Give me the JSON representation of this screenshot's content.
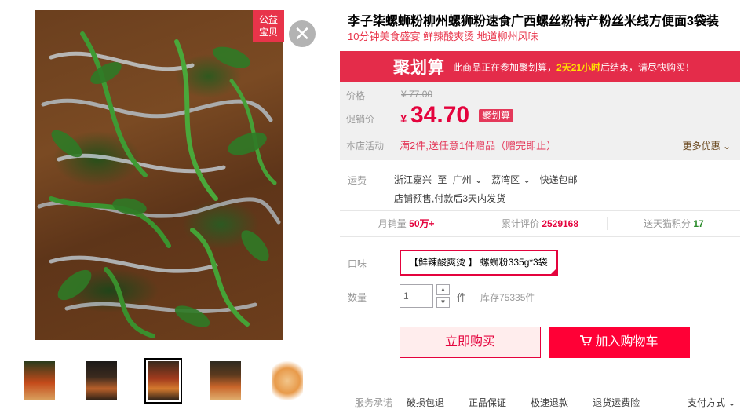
{
  "charity_badge": {
    "line1": "公益",
    "line2": "宝贝"
  },
  "product": {
    "title": "李子柒螺蛳粉柳州螺狮粉速食广西螺丝粉特产粉丝米线方便面3袋装",
    "subtitle": "10分钟美食盛宴 鲜辣酸爽烫 地道柳州风味"
  },
  "ju_banner": {
    "logo": "聚划算",
    "text_before": "此商品正在参加聚划算，",
    "time": "2天21小时",
    "text_after": "后结束，请尽快购买！"
  },
  "price": {
    "label_price": "价格",
    "original": "¥ 77.00",
    "label_promo": "促销价",
    "currency": "¥",
    "promo": "34.70",
    "promo_tag": "聚划算",
    "label_activity": "本店活动",
    "activity": "满2件,送任意1件赠品（赠完即止）",
    "more_offers": "更多优惠"
  },
  "shipping": {
    "label": "运费",
    "from": "浙江嘉兴",
    "to_word": "至",
    "city": "广州",
    "district": "荔湾区",
    "method": "快递包邮",
    "note": "店铺预售,付款后3天内发货"
  },
  "stats": {
    "monthly_label": "月销量",
    "monthly_value": "50万+",
    "reviews_label": "累计评价",
    "reviews_value": "2529168",
    "points_label": "送天猫积分",
    "points_value": "17"
  },
  "flavor": {
    "label": "口味",
    "option": "【鲜辣酸爽烫 】 螺蛳粉335g*3袋"
  },
  "quantity": {
    "label": "数量",
    "value": "1",
    "unit": "件",
    "stock": "库存75335件"
  },
  "buttons": {
    "buy_now": "立即购买",
    "add_to_cart": "加入购物车"
  },
  "services": {
    "label": "服务承诺",
    "items": [
      "破损包退",
      "正品保证",
      "极速退款",
      "退货运费险"
    ],
    "payment": "支付方式"
  },
  "colors": {
    "brand_red": "#e4033d",
    "cart_red": "#ff0036",
    "ju_red": "#e42c4a"
  }
}
